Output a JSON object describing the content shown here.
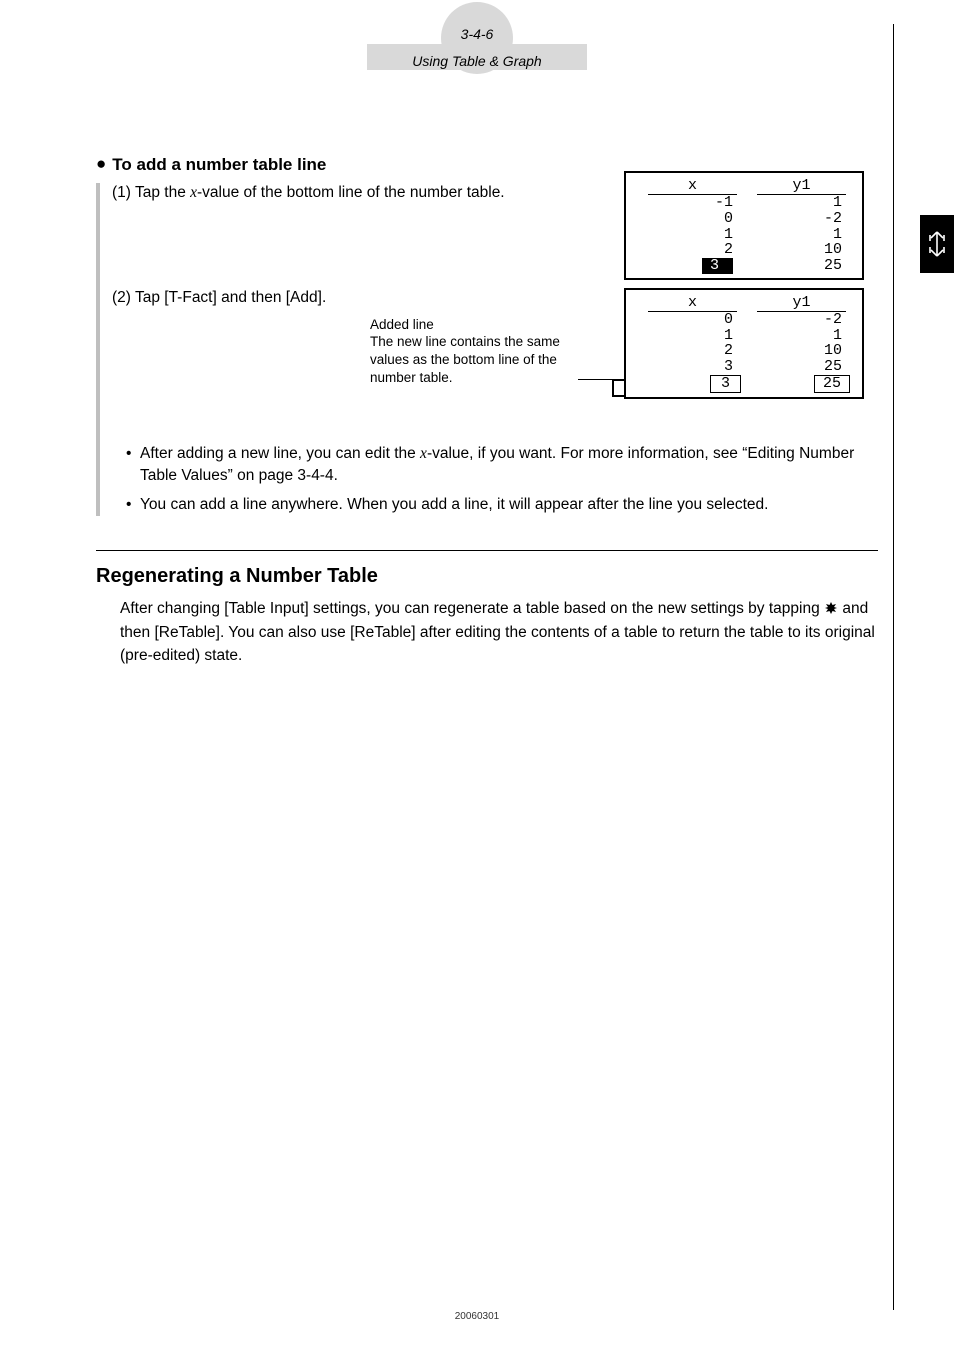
{
  "header": {
    "page_num": "3-4-6",
    "title": "Using Table & Graph"
  },
  "section1": {
    "heading": "To add a number table line",
    "step1_prefix": "(1) Tap the ",
    "step1_var": "x",
    "step1_suffix": "-value of the bottom line of the number table.",
    "step2": "(2) Tap [T-Fact] and then [Add].",
    "caption_l1": "Added line",
    "caption_l2": "The new line contains the same values as the bottom line of the number table."
  },
  "table1": {
    "h1": "x",
    "h2": "y1",
    "rows": [
      {
        "x": "-1",
        "y": "1"
      },
      {
        "x": "0",
        "y": "-2"
      },
      {
        "x": "1",
        "y": "1"
      },
      {
        "x": "2",
        "y": "10"
      },
      {
        "x": "3",
        "y": "25",
        "sel": true
      }
    ]
  },
  "table2": {
    "h1": "x",
    "h2": "y1",
    "rows": [
      {
        "x": "0",
        "y": "-2"
      },
      {
        "x": "1",
        "y": "1"
      },
      {
        "x": "2",
        "y": "10"
      },
      {
        "x": "3",
        "y": "25"
      },
      {
        "x": "3",
        "y": "25",
        "box": true
      }
    ]
  },
  "notes": {
    "n1_a": "After adding a new line, you can edit the ",
    "n1_var": "x",
    "n1_b": "-value, if you want. For more information, see “Editing Number Table Values” on page 3-4-4.",
    "n2": "You can add a line anywhere. When you add a line, it will appear after the line you selected."
  },
  "section2": {
    "heading": "Regenerating a Number Table",
    "body_a": "After changing [Table Input] settings, you can regenerate a table based on the new settings by tapping ",
    "body_b": " and then [ReTable]. You can also use [ReTable] after editing the contents of a table to return the table to its original (pre-edited) state."
  },
  "footer": {
    "id": "20060301"
  }
}
